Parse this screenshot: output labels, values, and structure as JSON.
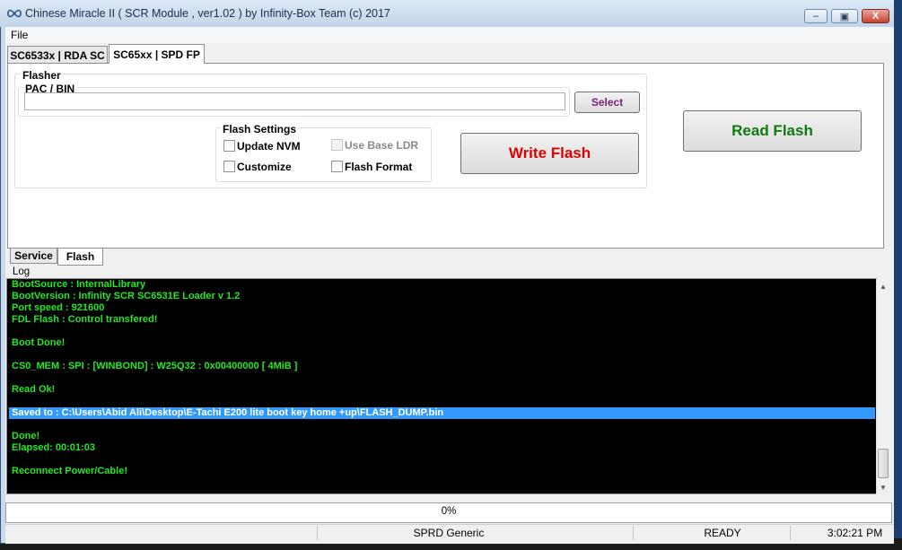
{
  "window": {
    "title": "Chinese Miracle II ( SCR Module , ver1.02  ) by Infinity-Box Team (c) 2017",
    "controls": {
      "minimize": "–",
      "maximize": "▣",
      "close": "X"
    }
  },
  "menu": {
    "file": "File"
  },
  "tabs": {
    "top": [
      "SC6533x | RDA SC",
      "SC65xx | SPD FP"
    ],
    "active_top": "SC65xx | SPD FP",
    "bottom": [
      "Service",
      "Flash"
    ],
    "active_bottom": "Flash"
  },
  "flasher": {
    "group_label": "Flasher",
    "pac_label": "PAC / BIN",
    "pac_value": "",
    "select_button": "Select",
    "settings_label": "Flash Settings",
    "checkboxes": [
      {
        "label": "Update NVM",
        "checked": false,
        "enabled": true
      },
      {
        "label": "Use Base LDR",
        "checked": false,
        "enabled": false
      },
      {
        "label": "Customize",
        "checked": false,
        "enabled": true
      },
      {
        "label": "Flash Format",
        "checked": false,
        "enabled": true
      }
    ],
    "write_button": "Write Flash",
    "read_button": "Read Flash"
  },
  "log": {
    "label": "Log",
    "lines": [
      "BootSource  :  InternalLibrary",
      "BootVersion : Infinity SCR SC6531E Loader v 1.2",
      "Port speed : 921600",
      "FDL Flash  : Control transfered!",
      "",
      "Boot Done!",
      "",
      "CS0_MEM : SPI : [WINBOND] : W25Q32 : 0x00400000 [ 4MiB ]",
      "",
      "Read Ok!",
      "",
      "Saved to : C:\\Users\\Abid Ali\\Desktop\\E-Tachi E200 lite boot key home +up\\FLASH_DUMP.bin",
      "",
      "Done!",
      "Elapsed: 00:01:03",
      "",
      "Reconnect Power/Cable!"
    ],
    "selected_line": 11,
    "text_color": "#22e822",
    "selection_color": "#3399ff"
  },
  "progress": {
    "value": 0,
    "text": "0%"
  },
  "status": {
    "platform": "SPRD Generic",
    "state": "READY",
    "time": "3:02:21 PM"
  }
}
